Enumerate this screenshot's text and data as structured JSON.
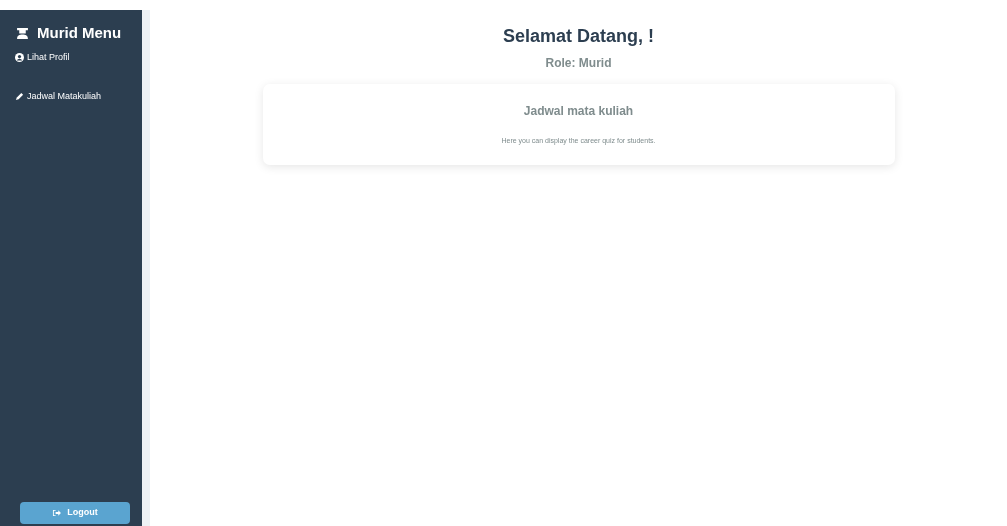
{
  "sidebar": {
    "title": "Murid Menu",
    "items": [
      {
        "label": "Lihat Profil",
        "kind": "profile"
      },
      {
        "label": "Jadwal Matakuliah",
        "kind": "schedule"
      }
    ],
    "logout": "Logout"
  },
  "main": {
    "heading": "Selamat Datang, !",
    "role": "Role: Murid",
    "card": {
      "title": "Jadwal mata kuliah",
      "text": "Here you can display the career quiz for students."
    }
  }
}
